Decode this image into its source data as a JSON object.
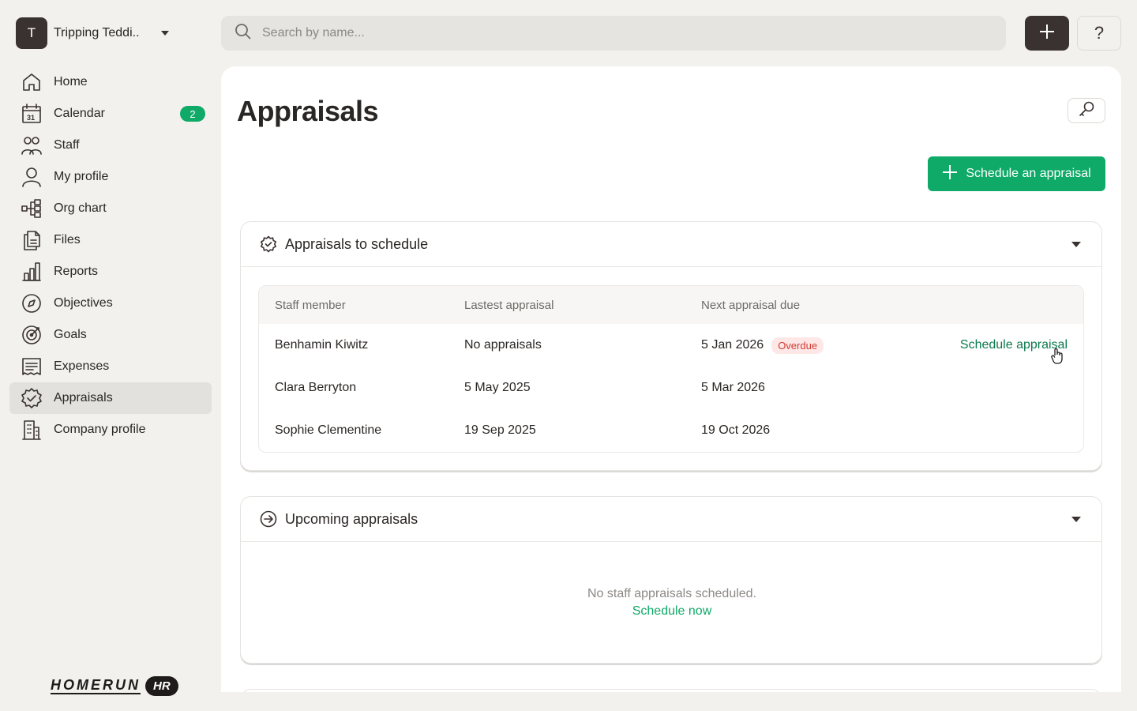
{
  "org": {
    "initial": "T",
    "name": "Tripping Teddi.."
  },
  "search": {
    "placeholder": "Search by name..."
  },
  "topbar": {
    "help_label": "?"
  },
  "sidebar": {
    "items": [
      {
        "label": "Home",
        "icon": "home-icon"
      },
      {
        "label": "Calendar",
        "icon": "calendar-icon",
        "badge": "2"
      },
      {
        "label": "Staff",
        "icon": "staff-icon"
      },
      {
        "label": "My profile",
        "icon": "user-icon"
      },
      {
        "label": "Org chart",
        "icon": "org-chart-icon"
      },
      {
        "label": "Files",
        "icon": "files-icon"
      },
      {
        "label": "Reports",
        "icon": "bar-chart-icon"
      },
      {
        "label": "Objectives",
        "icon": "compass-icon"
      },
      {
        "label": "Goals",
        "icon": "target-icon"
      },
      {
        "label": "Expenses",
        "icon": "receipt-icon"
      },
      {
        "label": "Appraisals",
        "icon": "badge-check-icon",
        "active": true
      },
      {
        "label": "Company profile",
        "icon": "building-icon"
      }
    ],
    "calendar_icon_day": "31"
  },
  "brand": {
    "word": "HOMERUN",
    "suffix": "HR"
  },
  "main": {
    "title": "Appraisals",
    "primary_button": "Schedule an appraisal",
    "to_schedule": {
      "title": "Appraisals to schedule",
      "columns": [
        "Staff member",
        "Lastest appraisal",
        "Next appraisal due"
      ],
      "rows": [
        {
          "name": "Benhamin Kiwitz",
          "latest": "No appraisals",
          "next": "5 Jan 2026",
          "status": "Overdue",
          "action": "Schedule appraisal"
        },
        {
          "name": "Clara Berryton",
          "latest": "5 May 2025",
          "next": "5 Mar 2026"
        },
        {
          "name": "Sophie Clementine",
          "latest": "19 Sep 2025",
          "next": "19 Oct 2026"
        }
      ]
    },
    "upcoming": {
      "title": "Upcoming appraisals",
      "empty_text": "No staff appraisals scheduled.",
      "empty_link": "Schedule now"
    }
  },
  "colors": {
    "accent": "#0fa968",
    "dark": "#3a3230",
    "overdue": "#d23b32",
    "background": "#f2f1ee"
  }
}
